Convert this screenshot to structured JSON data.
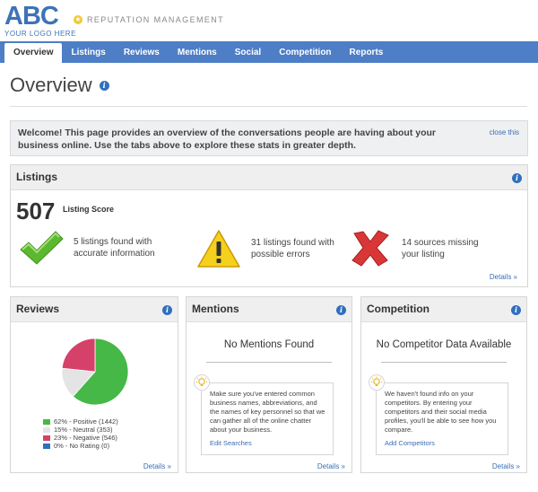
{
  "brand": {
    "logo": "ABC",
    "tagline": "YOUR LOGO HERE"
  },
  "product": {
    "label": "REPUTATION MANAGEMENT",
    "badge_icon": "star-icon"
  },
  "nav": {
    "tabs": [
      {
        "label": "Overview",
        "active": true
      },
      {
        "label": "Listings"
      },
      {
        "label": "Reviews"
      },
      {
        "label": "Mentions"
      },
      {
        "label": "Social"
      },
      {
        "label": "Competition"
      },
      {
        "label": "Reports"
      }
    ],
    "color": "#4d7ec6"
  },
  "page": {
    "title": "Overview"
  },
  "welcome": {
    "text": "Welcome! This page provides an overview of the conversations people are having about your business online. Use the tabs above to explore these stats in greater depth.",
    "close": "close this"
  },
  "listings": {
    "title": "Listings",
    "score": "507",
    "score_label": "Listing Score",
    "stats": [
      {
        "icon": "checkmark-icon",
        "text": "5 listings found with accurate information"
      },
      {
        "icon": "warning-icon",
        "text": "31 listings found with possible errors"
      },
      {
        "icon": "error-x-icon",
        "text": "14 sources missing your listing"
      }
    ],
    "details": "Details »"
  },
  "reviews": {
    "title": "Reviews",
    "details": "Details »"
  },
  "mentions": {
    "title": "Mentions",
    "empty_title": "No Mentions Found",
    "tip_text": "Make sure you've entered common business names, abbreviations, and the names of key personnel so that we can gather all of the online chatter about your business.",
    "tip_link": "Edit Searches",
    "details": "Details »"
  },
  "competition": {
    "title": "Competition",
    "empty_title": "No Competitor Data Available",
    "tip_text": "We haven't found info on your competitors. By entering your competitors and their social media profiles, you'll be able to see how you compare.",
    "tip_link": "Add Competitors",
    "details": "Details »"
  },
  "chart_data": {
    "type": "pie",
    "categories": [
      "Positive",
      "Neutral",
      "Negative",
      "No Rating"
    ],
    "values": [
      1442,
      353,
      546,
      0
    ],
    "percents": [
      62,
      15,
      23,
      0
    ],
    "labels": [
      "62% - Positive (1442)",
      "15% - Neutral (353)",
      "23% - Negative (546)",
      "0% - No Rating (0)"
    ],
    "colors": [
      "#45b847",
      "#e4e4e4",
      "#d6416a",
      "#2f6fbf"
    ]
  }
}
